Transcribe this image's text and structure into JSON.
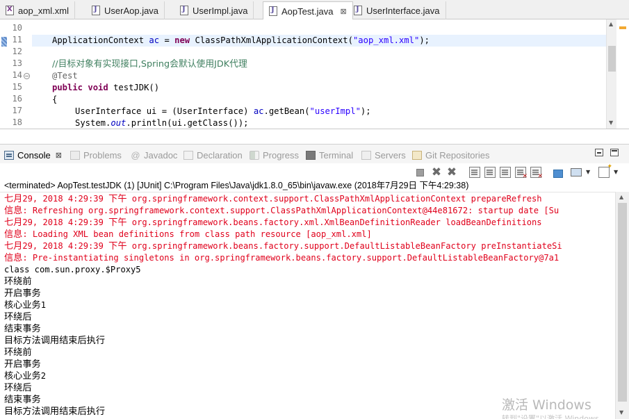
{
  "editor_tabs": [
    {
      "label": "aop_xml.xml",
      "icon": "xml-file-icon",
      "active": false
    },
    {
      "label": "UserAop.java",
      "icon": "java-file-icon",
      "active": false
    },
    {
      "label": "UserImpl.java",
      "icon": "java-file-icon",
      "active": false
    },
    {
      "label": "AopTest.java",
      "icon": "java-file-icon",
      "active": true,
      "close": "⊠"
    },
    {
      "label": "UserInterface.java",
      "icon": "java-file-icon",
      "active": false
    }
  ],
  "editor": {
    "line_numbers": [
      "10",
      "11",
      "12",
      "13",
      "14",
      "15",
      "16",
      "17",
      "18"
    ],
    "fold_markers": {
      "14": "−"
    },
    "lines": {
      "l11": {
        "type": "ApplicationContext ",
        "var": "ac",
        "eq": " = ",
        "kw": "new",
        "ctor": " ClassPathXmlApplicationContext(",
        "arg": "\"aop_xml.xml\"",
        "end": ");"
      },
      "l13": {
        "comment": "//目标对象有实现接口,Spring会默认使用JDK代理"
      },
      "l14": {
        "annotation": "@Test"
      },
      "l15": {
        "kw1": "public",
        "kw2": "void",
        "name": " testJDK()"
      },
      "l16": {
        "text": "{"
      },
      "l17": {
        "type": "UserInterface ui = (UserInterface) ",
        "var": "ac",
        "call": ".getBean(",
        "arg": "\"userImpl\"",
        "end": ");"
      },
      "l18": {
        "pre": "System.",
        "field": "out",
        "post": ".println(ui.getClass());"
      }
    }
  },
  "views": {
    "tabs": [
      {
        "label": "Console",
        "active": true,
        "icon": "console-icon",
        "close": "⊠"
      },
      {
        "label": "Problems",
        "icon": "problems-icon"
      },
      {
        "label": "Javadoc",
        "icon": "javadoc-icon",
        "glyph": "@"
      },
      {
        "label": "Declaration",
        "icon": "declaration-icon"
      },
      {
        "label": "Progress",
        "icon": "progress-icon"
      },
      {
        "label": "Terminal",
        "icon": "terminal-icon"
      },
      {
        "label": "Servers",
        "icon": "servers-icon"
      },
      {
        "label": "Git Repositories",
        "icon": "git-repositories-icon"
      }
    ]
  },
  "console": {
    "status": "<terminated> AopTest.testJDK (1) [JUnit] C:\\Program Files\\Java\\jdk1.8.0_65\\bin\\javaw.exe (2018年7月29日 下午4:29:38)",
    "lines": [
      {
        "kind": "err",
        "cjk": "七月",
        "text": "29, 2018 4:29:39 ",
        "cjk2": "下午",
        "rest": " org.springframework.context.support.ClassPathXmlApplicationContext prepareRefresh"
      },
      {
        "kind": "err",
        "cjk": "信息",
        "text": ": Refreshing org.springframework.context.support.ClassPathXmlApplicationContext@44e81672: startup date [Su"
      },
      {
        "kind": "err",
        "cjk": "七月",
        "text": "29, 2018 4:29:39 ",
        "cjk2": "下午",
        "rest": " org.springframework.beans.factory.xml.XmlBeanDefinitionReader loadBeanDefinitions"
      },
      {
        "kind": "err",
        "cjk": "信息",
        "text": ": Loading XML bean definitions from class path resource [aop_xml.xml]"
      },
      {
        "kind": "err",
        "cjk": "七月",
        "text": "29, 2018 4:29:39 ",
        "cjk2": "下午",
        "rest": " org.springframework.beans.factory.support.DefaultListableBeanFactory preInstantiateSi"
      },
      {
        "kind": "err",
        "cjk": "信息",
        "text": ": Pre-instantiating singletons in org.springframework.beans.factory.support.DefaultListableBeanFactory@7a1"
      },
      {
        "kind": "out",
        "text": "class com.sun.proxy.$Proxy5"
      },
      {
        "kind": "out",
        "cjk": "环绕前"
      },
      {
        "kind": "out",
        "cjk": "开启事务"
      },
      {
        "kind": "out",
        "cjk": "核心业务",
        "text": "1"
      },
      {
        "kind": "out",
        "cjk": "环绕后"
      },
      {
        "kind": "out",
        "cjk": "结束事务"
      },
      {
        "kind": "out",
        "cjk": "目标方法调用结束后执行"
      },
      {
        "kind": "out",
        "cjk": "环绕前"
      },
      {
        "kind": "out",
        "cjk": "开启事务"
      },
      {
        "kind": "out",
        "cjk": "核心业务",
        "text": "2"
      },
      {
        "kind": "out",
        "cjk": "环绕后"
      },
      {
        "kind": "out",
        "cjk": "结束事务"
      },
      {
        "kind": "out",
        "cjk": "目标方法调用结束后执行"
      }
    ]
  },
  "watermark": {
    "title": "激活 Windows",
    "subtitle": "转到\"设置\"以激活 Windows。"
  },
  "colors": {
    "error": "#e0001b",
    "keyword": "#7f0055",
    "string": "#2a00ff",
    "comment": "#3f7f5f",
    "annotation": "#646464"
  }
}
